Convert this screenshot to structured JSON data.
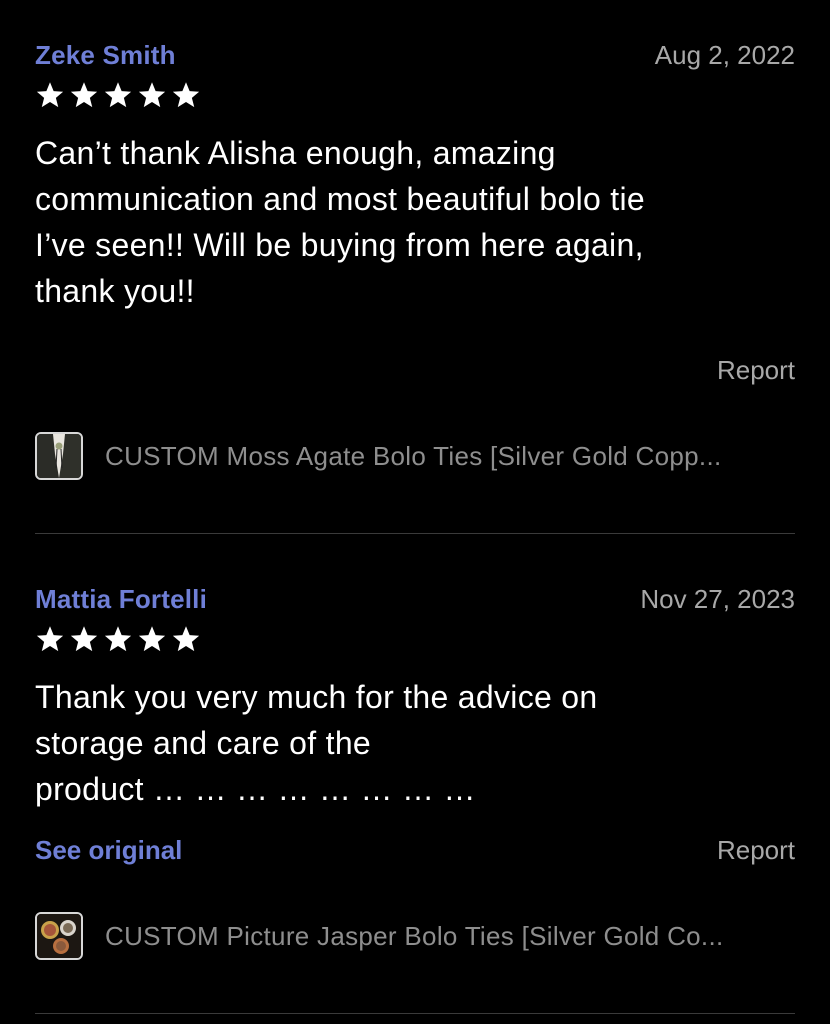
{
  "reviews": [
    {
      "reviewer": "Zeke Smith",
      "date": "Aug 2, 2022",
      "rating": 5,
      "text": "Can’t thank Alisha enough, amazing\ncommunication and most beautiful bolo tie\nI’ve seen!! Will be buying from here again,\nthank you!!",
      "report_label": "Report",
      "product_title": "CUSTOM Moss Agate Bolo Ties [Silver Gold Copp..."
    },
    {
      "reviewer": "Mattia Fortelli",
      "date": "Nov 27, 2023",
      "rating": 5,
      "text": "Thank you very much for the advice on\nstorage and care of the\nproduct … … … … … … … …",
      "see_original_label": "See original",
      "report_label": "Report",
      "product_title": "CUSTOM Picture Jasper Bolo Ties [Silver Gold Co..."
    }
  ],
  "colors": {
    "background": "#000000",
    "name_link": "#6f7fd6",
    "muted": "#a8a8a8",
    "divider": "#3a3a3a"
  }
}
